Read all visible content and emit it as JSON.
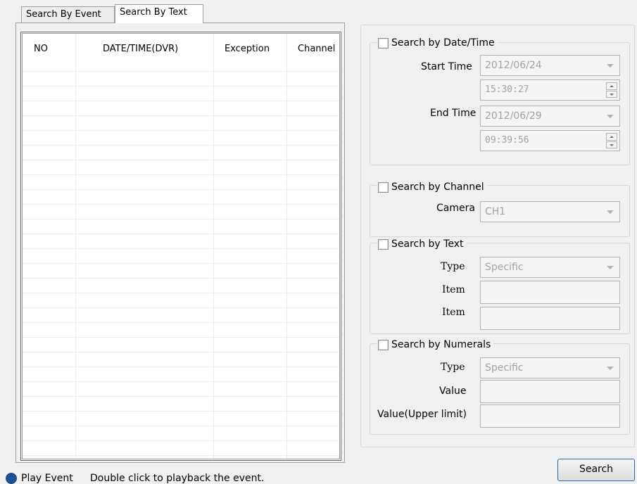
{
  "tabs": [
    {
      "label": "Search By Event",
      "active": false
    },
    {
      "label": "Search By Text",
      "active": true
    }
  ],
  "list": {
    "columns": [
      "NO",
      "DATE/TIME(DVR)",
      "Exception",
      "Channel"
    ],
    "rows": []
  },
  "date_time_group": {
    "legend": "Search by Date/Time",
    "checked": false,
    "start_label": "Start Time",
    "start_date": "2012/06/24",
    "start_time": "15:30:27",
    "end_label": "End Time",
    "end_date": "2012/06/29",
    "end_time": "09:39:56"
  },
  "channel_group": {
    "legend": "Search by Channel",
    "checked": false,
    "camera_label": "Camera",
    "camera_value": "CH1"
  },
  "text_group": {
    "legend": "Search by Text",
    "checked": false,
    "type_label": "Type",
    "type_value": "Specific",
    "item1_label": "Item",
    "item1_value": "",
    "item2_label": "Item",
    "item2_value": ""
  },
  "numerals_group": {
    "legend": "Search by Numerals",
    "checked": false,
    "type_label": "Type",
    "type_value": "Specific",
    "value_label": "Value",
    "value_value": "",
    "upper_label": "Value(Upper limit)",
    "upper_value": ""
  },
  "footer": {
    "search_button": "Search",
    "play_event_label": "Play Event",
    "hint": "Double click to playback the event."
  }
}
